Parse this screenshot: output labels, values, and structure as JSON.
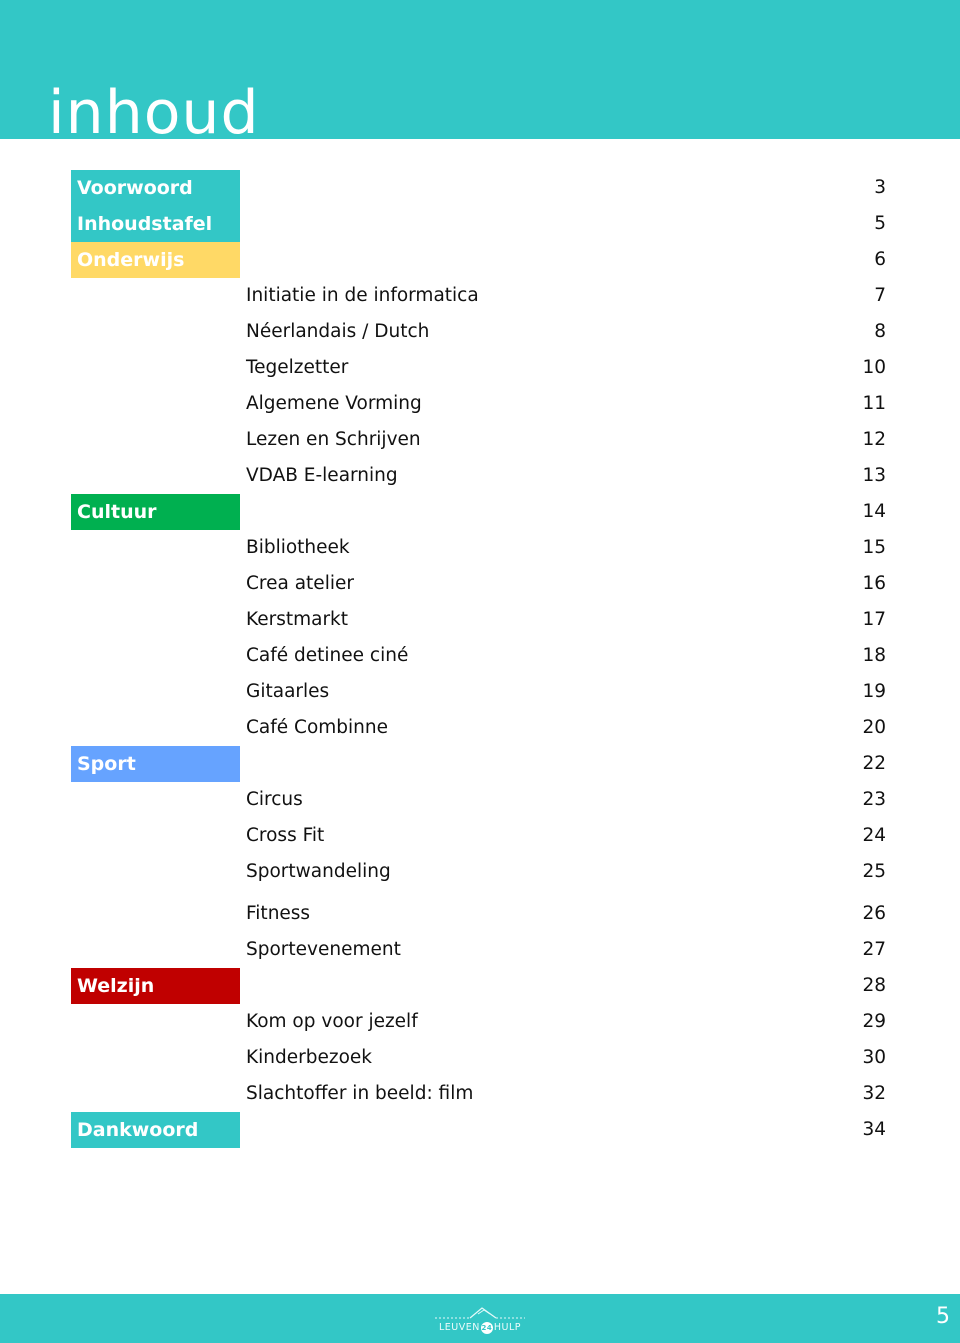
{
  "header": {
    "title": "inhoud"
  },
  "colors": {
    "brand": "#33c7c6",
    "voorwoord": "#33c7c6",
    "inhoudstafel": "#33c7c6",
    "onderwijs": "#ffd966",
    "cultuur": "#00b050",
    "sport": "#66a3ff",
    "welzijn": "#c00000",
    "dankwoord": "#33c7c6"
  },
  "toc": {
    "rows": [
      {
        "type": "category",
        "label": "Voorwoord",
        "page": "3",
        "color": "#33c7c6"
      },
      {
        "type": "category",
        "label": "Inhoudstafel",
        "page": "5",
        "color": "#33c7c6"
      },
      {
        "type": "category",
        "label": "Onderwijs",
        "page": "6",
        "color": "#ffd966"
      },
      {
        "type": "item",
        "label": "Initiatie in de informatica",
        "page": "7"
      },
      {
        "type": "item",
        "label": "Néerlandais / Dutch",
        "page": "8"
      },
      {
        "type": "item",
        "label": "Tegelzetter",
        "page": "10"
      },
      {
        "type": "item",
        "label": "Algemene Vorming",
        "page": "11"
      },
      {
        "type": "item",
        "label": "Lezen en Schrijven",
        "page": "12"
      },
      {
        "type": "item",
        "label": "VDAB E-learning",
        "page": "13"
      },
      {
        "type": "category",
        "label": "Cultuur",
        "page": "14",
        "color": "#00b050"
      },
      {
        "type": "item",
        "label": "Bibliotheek",
        "page": "15"
      },
      {
        "type": "item",
        "label": "Crea atelier",
        "page": "16"
      },
      {
        "type": "item",
        "label": "Kerstmarkt",
        "page": "17"
      },
      {
        "type": "item",
        "label": "Café detinee ciné",
        "page": "18"
      },
      {
        "type": "item",
        "label": "Gitaarles",
        "page": "19"
      },
      {
        "type": "item",
        "label": "Café Combinne",
        "page": "20"
      },
      {
        "type": "category",
        "label": "Sport",
        "page": "22",
        "color": "#66a3ff"
      },
      {
        "type": "item",
        "label": "Circus",
        "page": "23"
      },
      {
        "type": "item",
        "label": "Cross Fit",
        "page": "24"
      },
      {
        "type": "item",
        "label": "Sportwandeling",
        "page": "25"
      },
      {
        "type": "item",
        "label": "Fitness",
        "page": "26"
      },
      {
        "type": "item",
        "label": "Sportevenement",
        "page": "27"
      },
      {
        "type": "category",
        "label": "Welzijn",
        "page": "28",
        "color": "#c00000"
      },
      {
        "type": "item",
        "label": "Kom op voor jezelf",
        "page": "29"
      },
      {
        "type": "item",
        "label": "Kinderbezoek",
        "page": "30"
      },
      {
        "type": "item",
        "label": "Slachtoffer in beeld: film",
        "page": "32"
      },
      {
        "type": "category",
        "label": "Dankwoord",
        "page": "34",
        "color": "#33c7c6"
      }
    ]
  },
  "footer": {
    "logo_left": "LEUVEN",
    "logo_badge": "24",
    "logo_right": "HULP",
    "page_number": "5"
  }
}
